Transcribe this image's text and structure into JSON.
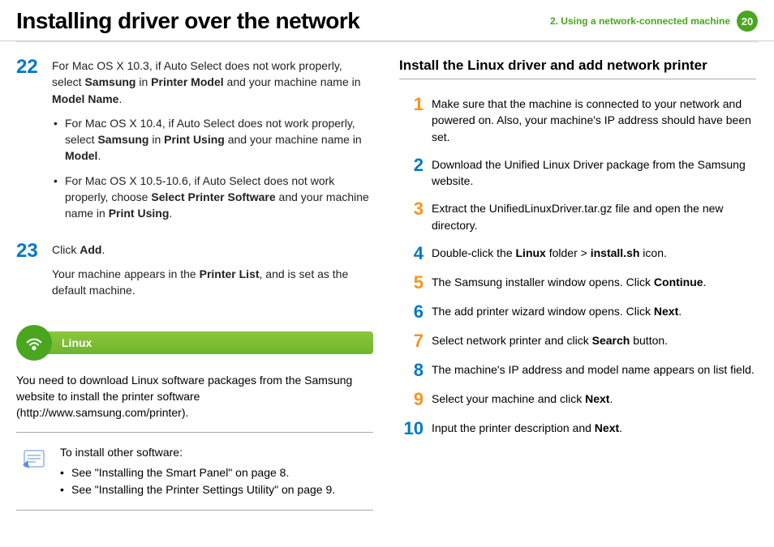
{
  "header": {
    "title": "Installing driver over the network",
    "chapter": "2.  Using a network-connected machine",
    "page": "20"
  },
  "left": {
    "step22": {
      "num": "22",
      "main_a": "For Mac OS X 10.3, if Auto Select does not work properly, select ",
      "main_b": "Samsung",
      "main_c": " in ",
      "main_d": "Printer Model",
      "main_e": " and your machine name in ",
      "main_f": "Model Name",
      "main_g": ".",
      "sub1_a": "For Mac OS X 10.4, if Auto Select does not work properly, select ",
      "sub1_b": "Samsung",
      "sub1_c": " in ",
      "sub1_d": "Print Using",
      "sub1_e": " and your machine name in ",
      "sub1_f": "Model",
      "sub1_g": ".",
      "sub2_a": "For Mac OS X 10.5-10.6, if Auto Select does not work properly, choose ",
      "sub2_b": "Select Printer Software",
      "sub2_c": " and your machine name in ",
      "sub2_d": "Print Using",
      "sub2_e": "."
    },
    "step23": {
      "num": "23",
      "line1_a": "Click ",
      "line1_b": "Add",
      "line1_c": ".",
      "line2_a": "Your machine appears in the ",
      "line2_b": "Printer List",
      "line2_c": ", and is set as the default machine."
    },
    "linux_label": "Linux",
    "linux_body": "You need to download Linux software packages from the Samsung website to install the printer software (http://www.samsung.com/printer).",
    "note": {
      "intro": "To install other software:",
      "li1": "See \"Installing the Smart Panel\" on page 8.",
      "li2": "See \"Installing the Printer Settings Utility\" on page 9."
    }
  },
  "right": {
    "heading": "Install the Linux driver and add network printer",
    "s1": {
      "n": "1",
      "t": "Make sure that the machine is connected to your network and powered on. Also, your machine's IP address should have been set."
    },
    "s2": {
      "n": "2",
      "t": "Download the Unified Linux Driver package from the Samsung website."
    },
    "s3": {
      "n": "3",
      "t": "Extract the UnifiedLinuxDriver.tar.gz file and open the new directory."
    },
    "s4": {
      "n": "4",
      "a": "Double-click the ",
      "b": "Linux",
      "c": " folder > ",
      "d": "install.sh",
      "e": " icon."
    },
    "s5": {
      "n": "5",
      "a": "The Samsung installer window opens. Click ",
      "b": "Continue",
      "c": "."
    },
    "s6": {
      "n": "6",
      "a": "The add printer wizard window opens. Click ",
      "b": "Next",
      "c": "."
    },
    "s7": {
      "n": "7",
      "a": "Select network printer and click ",
      "b": "Search",
      "c": " button."
    },
    "s8": {
      "n": "8",
      "t": "The machine's IP address and model name appears on list field."
    },
    "s9": {
      "n": "9",
      "a": "Select your machine and click ",
      "b": "Next",
      "c": "."
    },
    "s10": {
      "n": "10",
      "a": "Input the printer description and ",
      "b": "Next",
      "c": "."
    }
  }
}
